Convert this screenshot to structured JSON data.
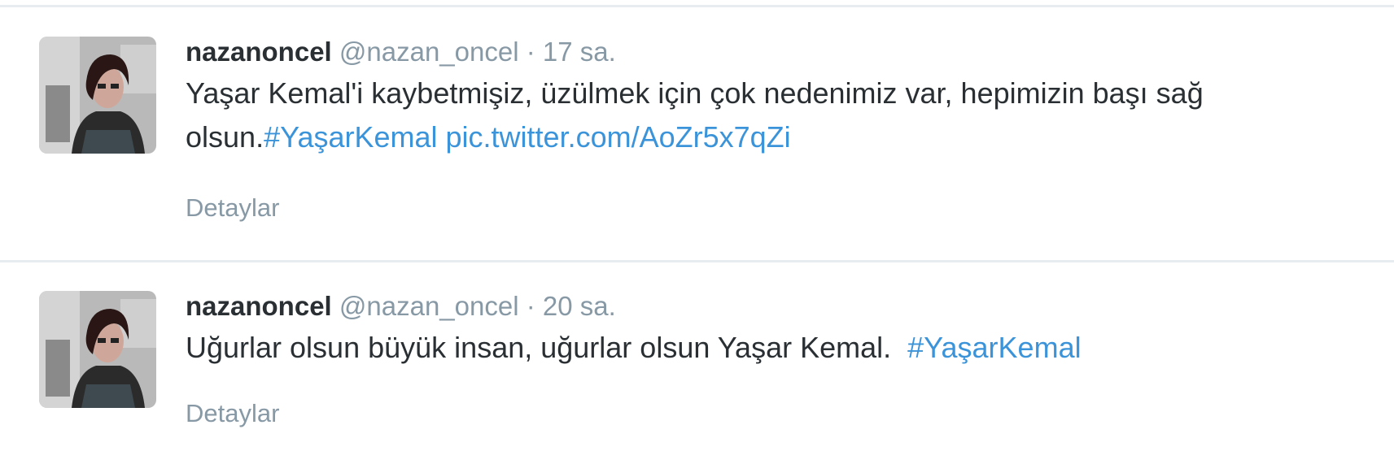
{
  "colors": {
    "link": "#3b94d9",
    "muted": "#8899a6",
    "text": "#292f33",
    "divider": "#e6ecf0"
  },
  "tweets": [
    {
      "fullname": "nazanoncel",
      "username": "@nazan_oncel",
      "separator": "·",
      "time": "17 sa.",
      "text_part1": "Yaşar Kemal'i kaybetmişiz, üzülmek için çok nedenimiz var, hepimizin başı sağ olsun.",
      "hashtag": "#YaşarKemal",
      "pic_link": "pic.twitter.com/AoZr5x7qZi",
      "details_label": "Detaylar",
      "avatar_icon": "profile-photo"
    },
    {
      "fullname": "nazanoncel",
      "username": "@nazan_oncel",
      "separator": "·",
      "time": "20 sa.",
      "text_part1": "Uğurlar olsun büyük insan, uğurlar olsun Yaşar Kemal.",
      "hashtag": "#YaşarKemal",
      "details_label": "Detaylar",
      "avatar_icon": "profile-photo"
    }
  ]
}
